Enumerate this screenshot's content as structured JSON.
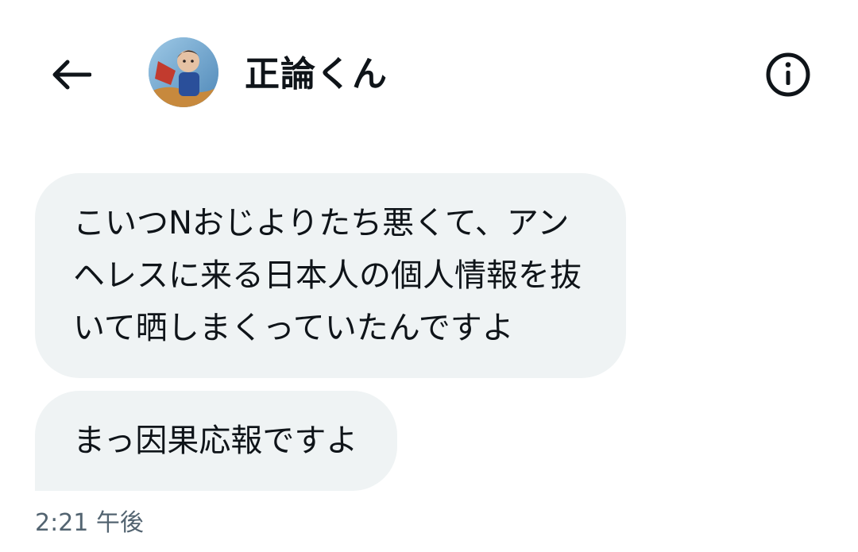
{
  "header": {
    "back_icon": "arrow-left-icon",
    "title": "正論くん",
    "info_icon": "info-circle-icon",
    "avatar_icon": "user-avatar"
  },
  "messages": [
    {
      "text": "こいつNおじよりたち悪くて、アン\nヘレスに来る日本人の個人情報を抜\nいて晒しまくっていたんですよ"
    },
    {
      "text": "まっ因果応報ですよ"
    }
  ],
  "timestamp": "2:21 午後",
  "colors": {
    "bubble_bg": "#eff3f4",
    "text": "#0f1419",
    "muted": "#536471"
  }
}
